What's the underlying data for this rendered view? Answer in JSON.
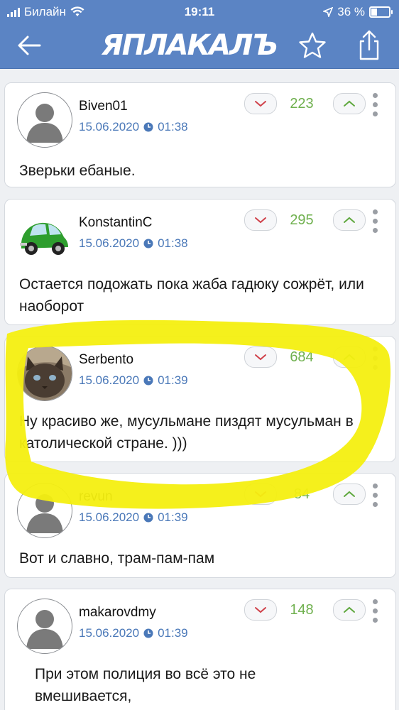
{
  "status_bar": {
    "carrier": "Билайн",
    "time": "19:11",
    "battery": "36 %",
    "battery_level": 0.36
  },
  "nav": {
    "logo": "ЯПЛАКАЛЪ",
    "icons": [
      "arrow-left-icon",
      "star-icon",
      "share-icon"
    ]
  },
  "comments": [
    {
      "username": "Biven01",
      "date": "15.06.2020",
      "time": "01:38",
      "score": "223",
      "text": "Зверьки ебаные.",
      "avatar": "default-avatar"
    },
    {
      "username": "KonstantinC",
      "date": "15.06.2020",
      "time": "01:38",
      "score": "295",
      "text": "Остается подожать пока жаба гадюку сожрёт, или наоборот",
      "avatar": "green-car-avatar"
    },
    {
      "username": "Serbento",
      "date": "15.06.2020",
      "time": "01:39",
      "score": "684",
      "text": "Ну красиво же, мусульмане пиздят мусульман в католической стране. )))",
      "avatar": "cat-avatar"
    },
    {
      "username": "revun",
      "date": "15.06.2020",
      "time": "01:39",
      "score": "84",
      "text": "Вот и славно, трам-пам-пам",
      "avatar": "default-avatar"
    },
    {
      "username": "makarovdmy",
      "date": "15.06.2020",
      "time": "01:39",
      "score": "148",
      "text": "При этом полиция во всё это не вмешивается,",
      "avatar": "default-avatar"
    }
  ],
  "colors": {
    "header": "#5b84c4",
    "score": "#6fb04e",
    "date": "#4a78b8",
    "highlight": "#f4ef10"
  }
}
